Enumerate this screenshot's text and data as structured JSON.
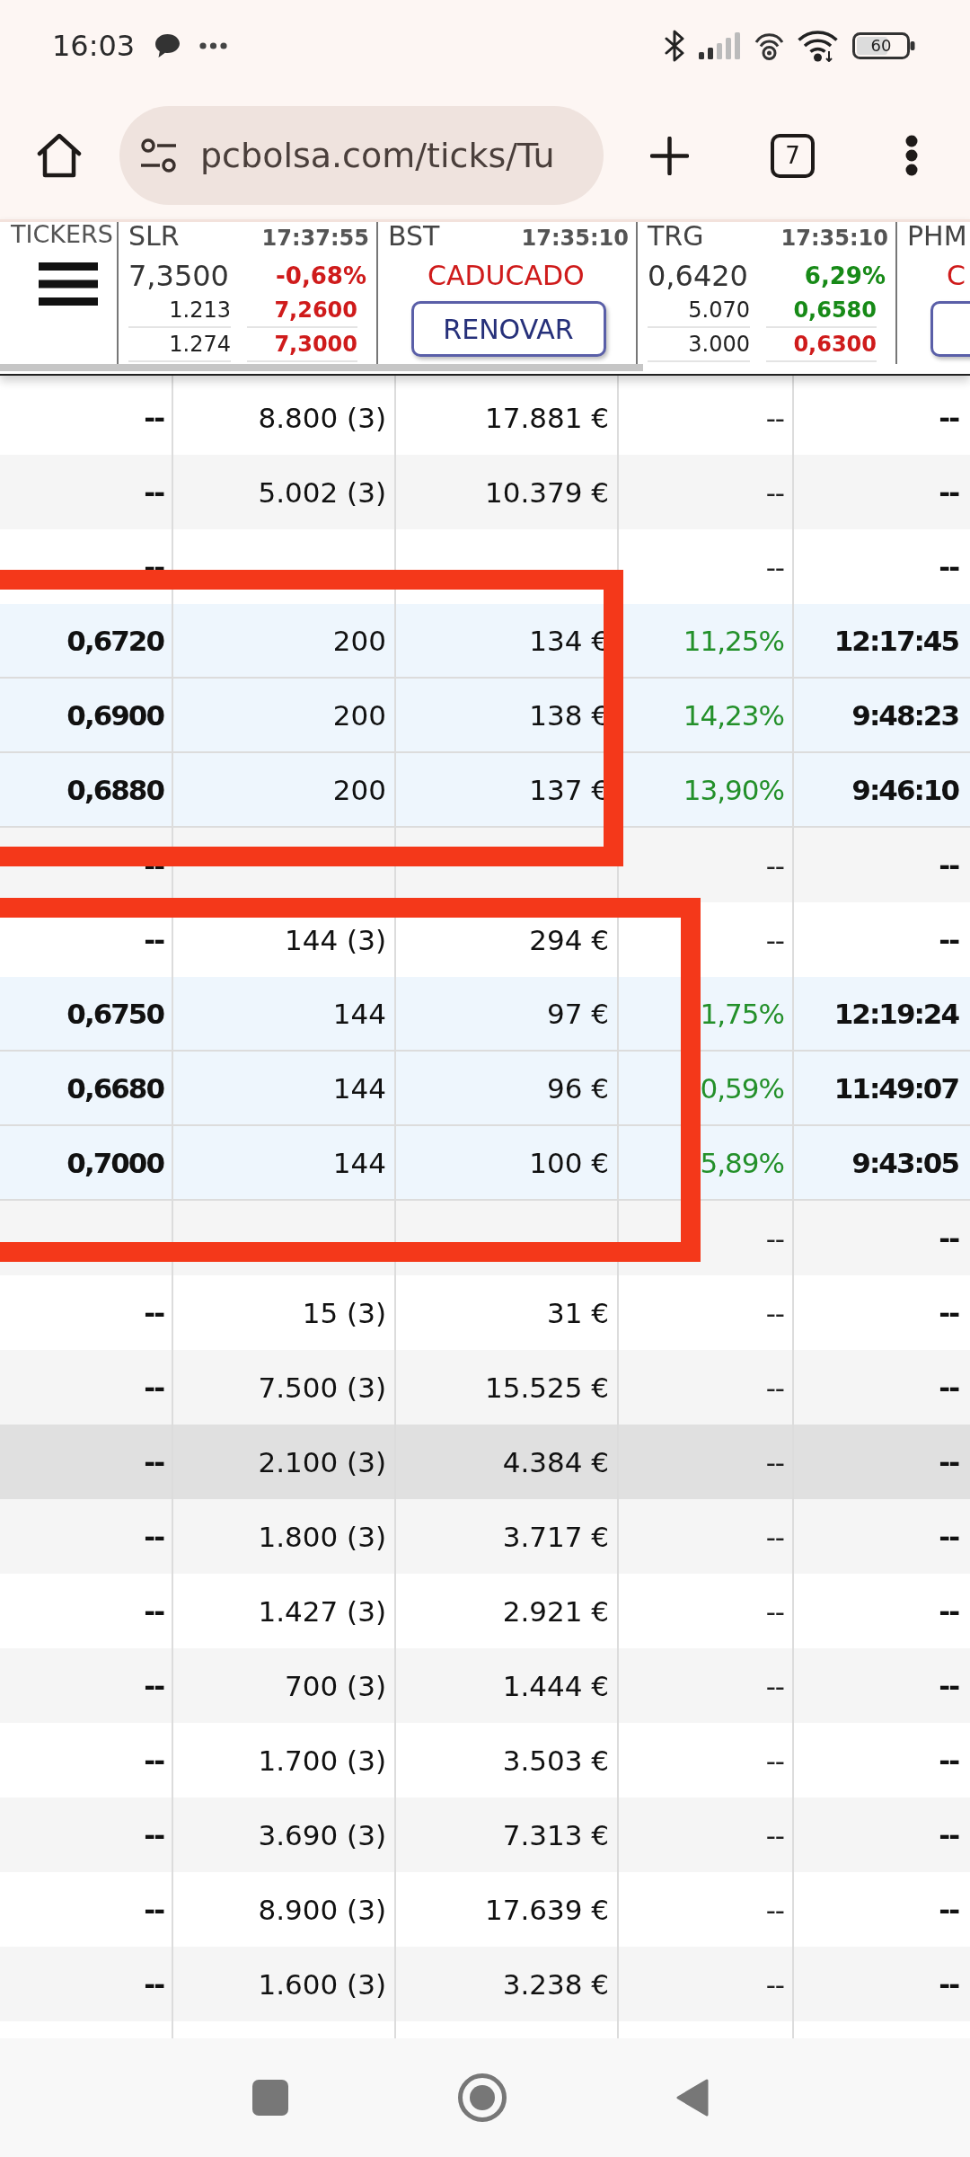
{
  "status_bar": {
    "time": "16:03",
    "battery": "60"
  },
  "browser": {
    "url": "pcbolsa.com/ticks/Tu",
    "tab_count": "7"
  },
  "ticker_strip": {
    "label": "TICKERS",
    "tickers": [
      {
        "kind": "quote",
        "symbol": "SLR",
        "time": "17:37:55",
        "price": "7,3500",
        "change": "-0,68%",
        "rising": false,
        "book": [
          {
            "quantity": "1.213",
            "price": "7,2600",
            "rising": false
          },
          {
            "quantity": "1.274",
            "price": "7,3000",
            "rising": false
          }
        ]
      },
      {
        "kind": "expired",
        "symbol": "BST",
        "time": "17:35:10",
        "status": "CADUCADO",
        "button": "RENOVAR"
      },
      {
        "kind": "quote",
        "symbol": "TRG",
        "time": "17:35:10",
        "price": "0,6420",
        "change": "6,29%",
        "rising": true,
        "book": [
          {
            "quantity": "5.070",
            "price": "0,6580",
            "rising": true
          },
          {
            "quantity": "3.000",
            "price": "0,6300",
            "rising": false
          }
        ]
      },
      {
        "kind": "expired",
        "symbol": "PHM",
        "status": "C"
      }
    ]
  },
  "table": {
    "rows": [
      {
        "kind": "group",
        "selected": false,
        "column_1": "--",
        "column_2": "8.800 (3)",
        "column_3": "17.881 €",
        "column_4": "--",
        "column_5": "--"
      },
      {
        "kind": "group",
        "selected": false,
        "column_1": "--",
        "column_2": "5.002 (3)",
        "column_3": "10.379 €",
        "column_4": "--",
        "column_5": "--"
      },
      {
        "kind": "group",
        "selected": false,
        "column_1": "--",
        "column_4": "--",
        "column_5": "--"
      },
      {
        "kind": "trade",
        "selected": false,
        "column_1": "0,6720",
        "column_2": "200",
        "column_3": "134 €",
        "column_4": "11,25%",
        "column_5": "12:17:45"
      },
      {
        "kind": "trade",
        "selected": false,
        "column_1": "0,6900",
        "column_2": "200",
        "column_3": "138 €",
        "column_4": "14,23%",
        "column_5": "9:48:23"
      },
      {
        "kind": "trade",
        "selected": false,
        "column_1": "0,6880",
        "column_2": "200",
        "column_3": "137 €",
        "column_4": "13,90%",
        "column_5": "9:46:10"
      },
      {
        "kind": "group",
        "selected": false,
        "column_1": "--",
        "column_4": "--",
        "column_5": "--"
      },
      {
        "kind": "group",
        "selected": false,
        "column_1": "--",
        "column_2": "144 (3)",
        "column_3": "294 €",
        "column_4": "--",
        "column_5": "--"
      },
      {
        "kind": "trade",
        "selected": false,
        "column_1": "0,6750",
        "column_2": "144",
        "column_3": "97 €",
        "column_4": "1,75%",
        "column_5": "12:19:24"
      },
      {
        "kind": "trade",
        "selected": false,
        "column_1": "0,6680",
        "column_2": "144",
        "column_3": "96 €",
        "column_4": "0,59%",
        "column_5": "11:49:07"
      },
      {
        "kind": "trade",
        "selected": false,
        "column_1": "0,7000",
        "column_2": "144",
        "column_3": "100 €",
        "column_4": "5,89%",
        "column_5": "9:43:05"
      },
      {
        "kind": "group",
        "selected": false,
        "column_4": "--",
        "column_5": "--"
      },
      {
        "kind": "group",
        "selected": false,
        "column_1": "--",
        "column_2": "15 (3)",
        "column_3": "31 €",
        "column_4": "--",
        "column_5": "--"
      },
      {
        "kind": "group",
        "selected": false,
        "column_1": "--",
        "column_2": "7.500 (3)",
        "column_3": "15.525 €",
        "column_4": "--",
        "column_5": "--"
      },
      {
        "kind": "group",
        "selected": true,
        "column_1": "--",
        "column_2": "2.100 (3)",
        "column_3": "4.384 €",
        "column_4": "--",
        "column_5": "--"
      },
      {
        "kind": "group",
        "selected": false,
        "column_1": "--",
        "column_2": "1.800 (3)",
        "column_3": "3.717 €",
        "column_4": "--",
        "column_5": "--"
      },
      {
        "kind": "group",
        "selected": false,
        "column_1": "--",
        "column_2": "1.427 (3)",
        "column_3": "2.921 €",
        "column_4": "--",
        "column_5": "--"
      },
      {
        "kind": "group",
        "selected": false,
        "column_1": "--",
        "column_2": "700 (3)",
        "column_3": "1.444 €",
        "column_4": "--",
        "column_5": "--"
      },
      {
        "kind": "group",
        "selected": false,
        "column_1": "--",
        "column_2": "1.700 (3)",
        "column_3": "3.503 €",
        "column_4": "--",
        "column_5": "--"
      },
      {
        "kind": "group",
        "selected": false,
        "column_1": "--",
        "column_2": "3.690 (3)",
        "column_3": "7.313 €",
        "column_4": "--",
        "column_5": "--"
      },
      {
        "kind": "group",
        "selected": false,
        "column_1": "--",
        "column_2": "8.900 (3)",
        "column_3": "17.639 €",
        "column_4": "--",
        "column_5": "--"
      },
      {
        "kind": "group",
        "selected": false,
        "column_1": "--",
        "column_2": "1.600 (3)",
        "column_3": "3.238 €",
        "column_4": "--",
        "column_5": "--"
      }
    ]
  },
  "annotations": [
    {
      "kind": "rectangle"
    },
    {
      "kind": "rectangle"
    }
  ]
}
